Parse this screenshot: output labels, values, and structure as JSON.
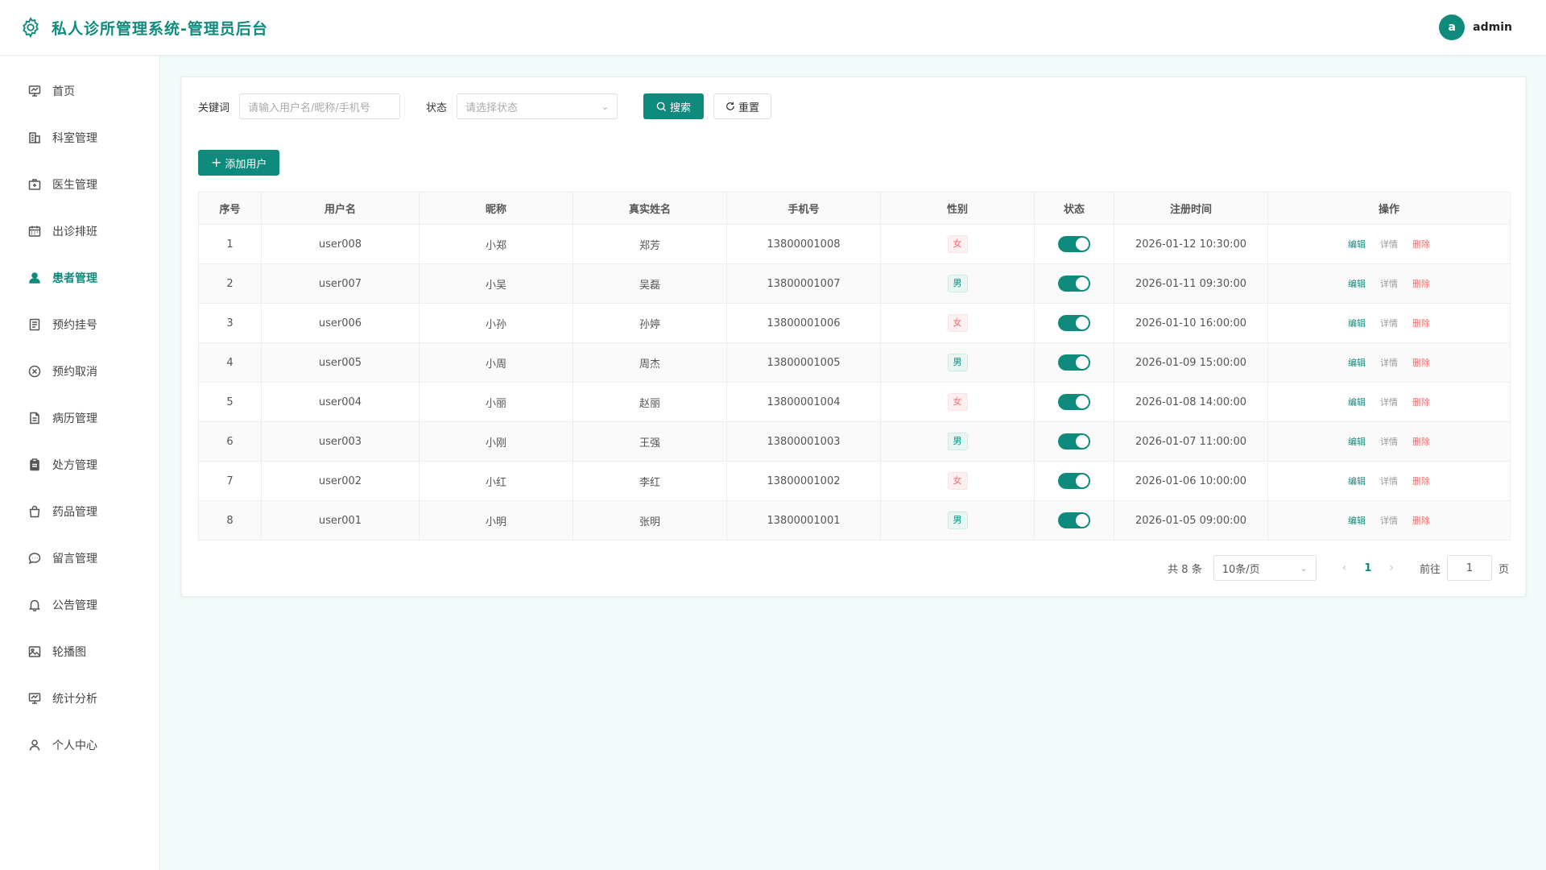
{
  "header": {
    "title": "私人诊所管理系统-管理员后台",
    "avatar_letter": "a",
    "username": "admin"
  },
  "sidebar": {
    "items": [
      {
        "label": "首页",
        "icon": "monitor-icon",
        "active": false
      },
      {
        "label": "科室管理",
        "icon": "building-icon",
        "active": false
      },
      {
        "label": "医生管理",
        "icon": "medkit-icon",
        "active": false
      },
      {
        "label": "出诊排班",
        "icon": "calendar-icon",
        "active": false
      },
      {
        "label": "患者管理",
        "icon": "user-icon",
        "active": true
      },
      {
        "label": "预约挂号",
        "icon": "document-icon",
        "active": false
      },
      {
        "label": "预约取消",
        "icon": "circle-x-icon",
        "active": false
      },
      {
        "label": "病历管理",
        "icon": "file-icon",
        "active": false
      },
      {
        "label": "处方管理",
        "icon": "clipboard-icon",
        "active": false
      },
      {
        "label": "药品管理",
        "icon": "bag-icon",
        "active": false
      },
      {
        "label": "留言管理",
        "icon": "chat-icon",
        "active": false
      },
      {
        "label": "公告管理",
        "icon": "bell-icon",
        "active": false
      },
      {
        "label": "轮播图",
        "icon": "picture-icon",
        "active": false
      },
      {
        "label": "统计分析",
        "icon": "chart-icon",
        "active": false
      },
      {
        "label": "个人中心",
        "icon": "person-icon",
        "active": false
      }
    ]
  },
  "filter": {
    "keyword_label": "关键词",
    "keyword_placeholder": "请输入用户名/昵称/手机号",
    "status_label": "状态",
    "status_placeholder": "请选择状态",
    "search_label": "搜索",
    "reset_label": "重置"
  },
  "toolbar": {
    "add_label": "添加用户"
  },
  "table": {
    "headers": [
      "序号",
      "用户名",
      "昵称",
      "真实姓名",
      "手机号",
      "性别",
      "状态",
      "注册时间",
      "操作"
    ],
    "ops": {
      "edit": "编辑",
      "detail": "详情",
      "delete": "删除"
    },
    "rows": [
      {
        "idx": "1",
        "username": "user008",
        "nickname": "小郑",
        "realname": "郑芳",
        "phone": "13800001008",
        "gender": "女",
        "enabled": true,
        "time": "2026-01-12 10:30:00"
      },
      {
        "idx": "2",
        "username": "user007",
        "nickname": "小吴",
        "realname": "吴磊",
        "phone": "13800001007",
        "gender": "男",
        "enabled": true,
        "time": "2026-01-11 09:30:00"
      },
      {
        "idx": "3",
        "username": "user006",
        "nickname": "小孙",
        "realname": "孙婷",
        "phone": "13800001006",
        "gender": "女",
        "enabled": true,
        "time": "2026-01-10 16:00:00"
      },
      {
        "idx": "4",
        "username": "user005",
        "nickname": "小周",
        "realname": "周杰",
        "phone": "13800001005",
        "gender": "男",
        "enabled": true,
        "time": "2026-01-09 15:00:00"
      },
      {
        "idx": "5",
        "username": "user004",
        "nickname": "小丽",
        "realname": "赵丽",
        "phone": "13800001004",
        "gender": "女",
        "enabled": true,
        "time": "2026-01-08 14:00:00"
      },
      {
        "idx": "6",
        "username": "user003",
        "nickname": "小刚",
        "realname": "王强",
        "phone": "13800001003",
        "gender": "男",
        "enabled": true,
        "time": "2026-01-07 11:00:00"
      },
      {
        "idx": "7",
        "username": "user002",
        "nickname": "小红",
        "realname": "李红",
        "phone": "13800001002",
        "gender": "女",
        "enabled": true,
        "time": "2026-01-06 10:00:00"
      },
      {
        "idx": "8",
        "username": "user001",
        "nickname": "小明",
        "realname": "张明",
        "phone": "13800001001",
        "gender": "男",
        "enabled": true,
        "time": "2026-01-05 09:00:00"
      }
    ]
  },
  "pagination": {
    "total_text": "共 8 条",
    "page_size": "10条/页",
    "current_page": "1",
    "goto_label": "前往",
    "goto_value": "1",
    "page_suffix": "页"
  },
  "colors": {
    "accent": "#0f8b7d",
    "danger": "#f56c6c"
  }
}
